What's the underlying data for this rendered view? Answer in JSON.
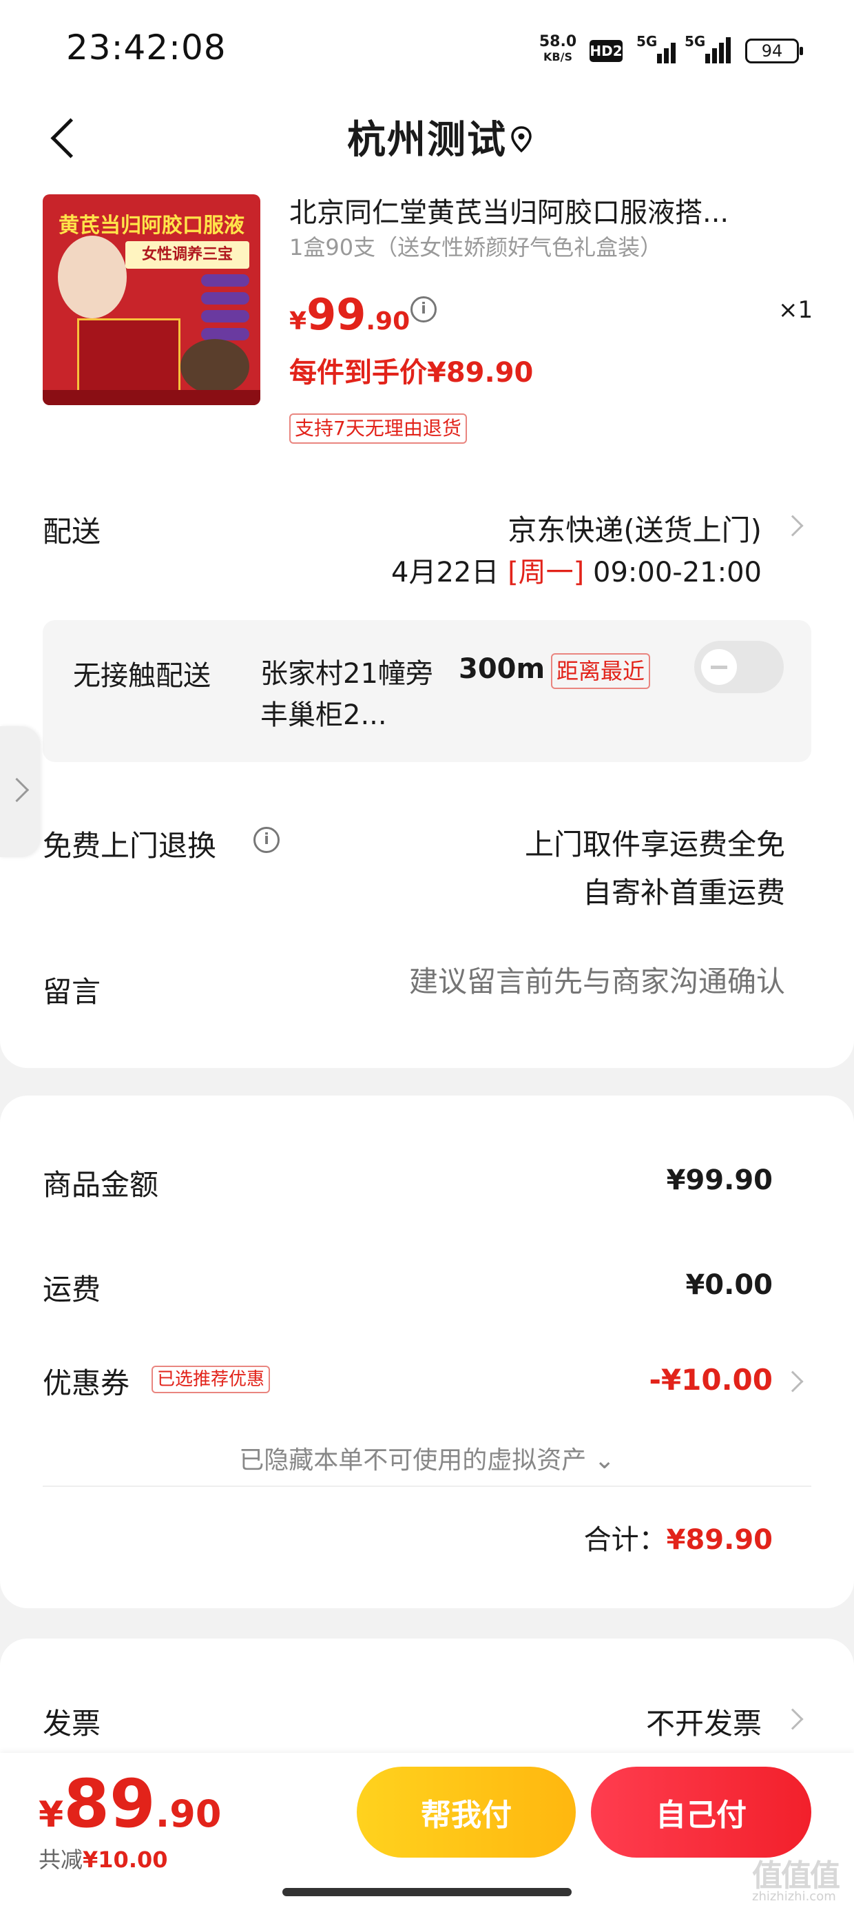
{
  "status_bar": {
    "time": "23:42:08",
    "net_speed_value": "58.0",
    "net_speed_unit": "KB/S",
    "hd": "HD2",
    "signal1": "5G",
    "signal2": "5G",
    "battery": "94"
  },
  "header": {
    "title": "杭州测试"
  },
  "product": {
    "title": "北京同仁堂黄芪当归阿胶口服液搭...",
    "spec": "1盒90支（送女性娇颜好气色礼盒装）",
    "price_currency": "¥",
    "price_int": "99",
    "price_dec": ".90",
    "quantity": "×1",
    "net_price": "每件到手价¥89.90",
    "return_policy": "支持7天无理由退货",
    "image_banner": "黄芪当归阿胶口服液",
    "image_sub": "女性调养三宝"
  },
  "delivery": {
    "label": "配送",
    "method": "京东快递(送货上门)",
    "date": "4月22日 ",
    "weekday": "[周一]",
    "hours": " 09:00-21:00"
  },
  "contactless": {
    "label": "无接触配送",
    "locker": "张家村21幢旁丰巢柜2...",
    "distance": "300m",
    "badge": "距离最近",
    "enabled": false
  },
  "free_return": {
    "label": "免费上门退换",
    "line1": "上门取件享运费全免",
    "line2": "自寄补首重运费"
  },
  "message": {
    "label": "留言",
    "placeholder": "建议留言前先与商家沟通确认"
  },
  "summary": {
    "subtotal_label": "商品金额",
    "subtotal_value": "¥99.90",
    "shipping_label": "运费",
    "shipping_value": "¥0.00",
    "coupon_label": "优惠券",
    "coupon_tag": "已选推荐优惠",
    "coupon_value": "-¥10.00",
    "hidden_assets": "已隐藏本单不可使用的虚拟资产 ⌄",
    "total_label": "合计：",
    "total_value": "¥89.90"
  },
  "invoice": {
    "label": "发票",
    "value": "不开发票"
  },
  "bottom": {
    "currency": "¥",
    "price_int": "89",
    "price_dec": ".90",
    "saved_label": "共减",
    "saved_value": "¥10.00",
    "help_pay": "帮我付",
    "self_pay": "自己付"
  },
  "watermark": {
    "text": "值值值",
    "sub": "zhizhizhi.com"
  },
  "colors": {
    "accent_red": "#e2231a",
    "help_pay_yellow": "#ffc21a",
    "self_pay_red": "#f2202b"
  }
}
